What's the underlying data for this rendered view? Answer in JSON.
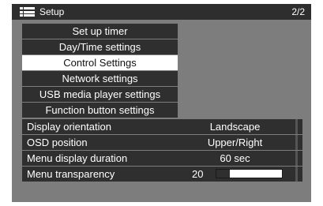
{
  "header": {
    "title": "Setup",
    "page_indicator": "2/2"
  },
  "main_menu": {
    "items": [
      {
        "label": "Set up timer"
      },
      {
        "label": "Day/Time settings"
      },
      {
        "label": "Control Settings",
        "selected": true
      },
      {
        "label": "Network settings"
      },
      {
        "label": "USB media player settings"
      },
      {
        "label": "Function button settings"
      }
    ]
  },
  "settings": {
    "display_orientation": {
      "label": "Display orientation",
      "value": "Landscape"
    },
    "osd_position": {
      "label": "OSD position",
      "value": "Upper/Right"
    },
    "menu_display_duration": {
      "label": "Menu display duration",
      "value": "60 sec"
    },
    "menu_transparency": {
      "label": "Menu transparency",
      "value": "20",
      "level_fraction": 0.2
    }
  },
  "colors": {
    "background": "#7d7d7d",
    "row": "#2f2f2f",
    "selected": "#ffffff",
    "titlebar": "#2e2e2e"
  }
}
